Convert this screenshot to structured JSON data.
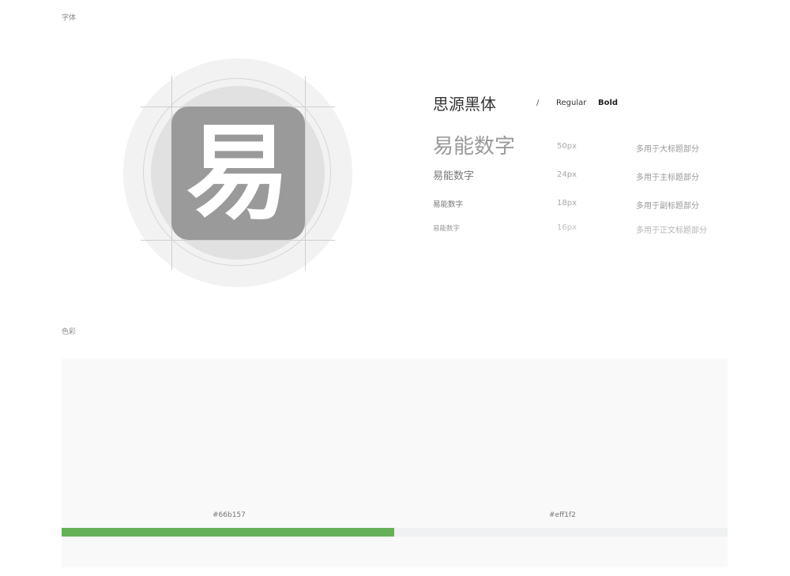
{
  "sections": {
    "font_label": "字体",
    "color_label": "色彩"
  },
  "logo": {
    "glyph": "易",
    "tile_color": "#9a9a9a",
    "icon": "app-logo-icon"
  },
  "typography": {
    "font_name": "思源黑体",
    "separator": "/",
    "weights": [
      "Regular",
      "Bold"
    ],
    "specs": [
      {
        "sample": "易能数字",
        "size": "50px",
        "usage": "多用于大标题部分"
      },
      {
        "sample": "易能数字",
        "size": "24px",
        "usage": "多用于主标题部分"
      },
      {
        "sample": "易能数字",
        "size": "18px",
        "usage": "多用于副标题部分"
      },
      {
        "sample": "易能数字",
        "size": "16px",
        "usage": "多用于正文标题部分"
      }
    ]
  },
  "palette": [
    {
      "hex": "#66b157",
      "label": "#66b157"
    },
    {
      "hex": "#eff1f2",
      "label": "#eff1f2"
    }
  ]
}
